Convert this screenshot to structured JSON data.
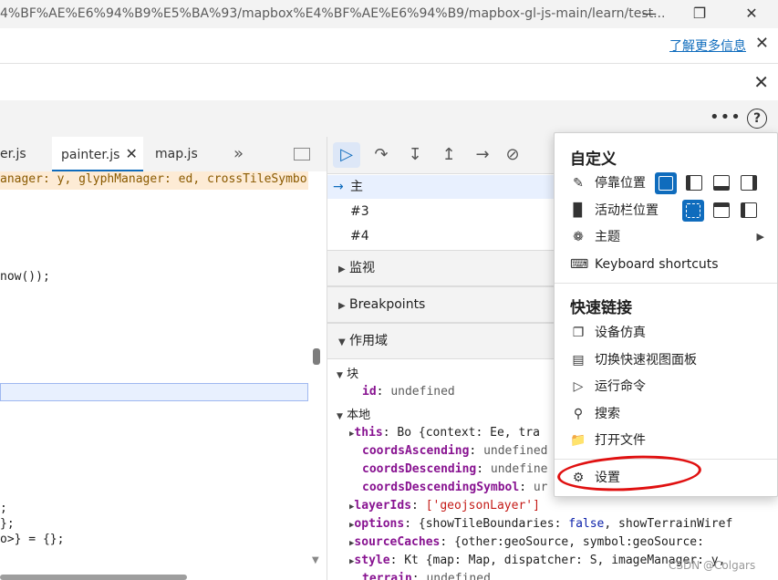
{
  "titlebar": {
    "url": "4%BF%AE%E6%94%B9%E5%BA%93/mapbox%E4%BF%AE%E6%94%B9/mapbox-gl-js-main/learn/test..."
  },
  "infobar": {
    "learn_more": "了解更多信息"
  },
  "editor_tabs": [
    "er.js",
    "painter.js",
    "map.js"
  ],
  "editor": {
    "lines": [
      "anager: y, glyphManager: ed, crossTileSymbo",
      "now());",
      ";",
      "};",
      "o>} = {};"
    ]
  },
  "callstack": {
    "frames": [
      "主",
      "#3",
      "#4"
    ]
  },
  "sections": {
    "watch": "监视",
    "breakpoints": "Breakpoints",
    "scope": "作用域"
  },
  "scope": {
    "block_label": "块",
    "block_id_key": "id",
    "block_id_val": "undefined",
    "local_label": "本地",
    "this_key": "this",
    "this_val": "Bo {context: Ee, tra",
    "coords_asc_key": "coordsAscending",
    "coords_asc_val": "undefined",
    "coords_desc_key": "coordsDescending",
    "coords_desc_val": "undefine",
    "coords_desc_sym_key": "coordsDescendingSymbol",
    "coords_desc_sym_val": "ur",
    "layerids_key": "layerIds",
    "layerids_val": "['geojsonLayer']",
    "options_key": "options",
    "options_val_a": "{showTileBoundaries: ",
    "options_val_b": "false",
    "options_val_c": ", showTerrainWiref",
    "sourcecaches_key": "sourceCaches",
    "sourcecaches_val": "{other:geoSource, symbol:geoSource:",
    "style_key": "style",
    "style_val": "Kt {map: Map, dispatcher: S, imageManager: y,",
    "terrain_key": "terrain",
    "terrain_val": "undefined"
  },
  "menu": {
    "customize_header": "自定义",
    "dock_label": "停靠位置",
    "activity_bar_label": "活动栏位置",
    "theme_label": "主题",
    "shortcuts_label": "Keyboard shortcuts",
    "quicklinks_header": "快速链接",
    "device_emulation": "设备仿真",
    "quick_view": "切换快速视图面板",
    "run_command": "运行命令",
    "search": "搜索",
    "open_file": "打开文件",
    "settings": "设置"
  },
  "watermark": "CSDN @Colgars",
  "colors": {
    "accent": "#0f6cbd",
    "annotation": "#e01010"
  }
}
